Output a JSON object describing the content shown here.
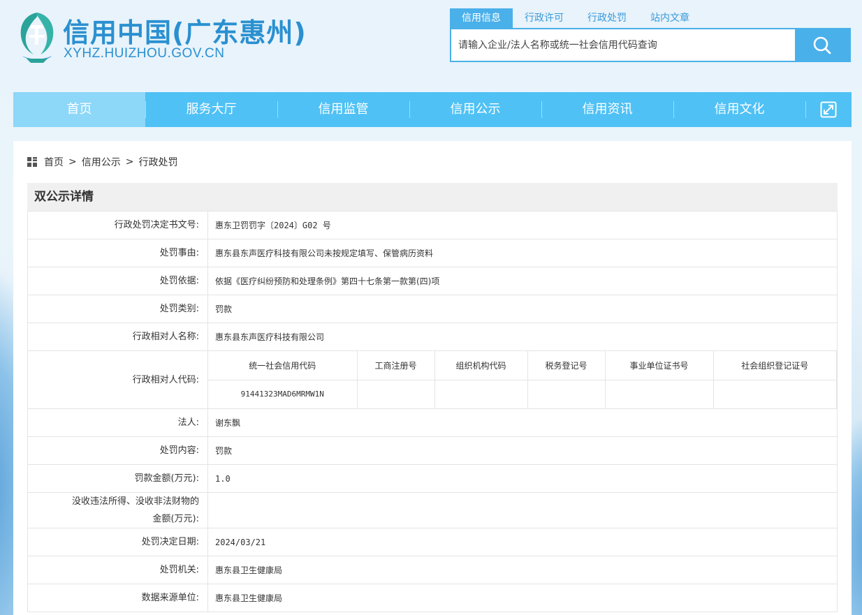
{
  "header": {
    "site_title": "信用中国(广东惠州)",
    "site_domain": "XYHZ.HUIZHOU.GOV.CN",
    "search_tabs": [
      "信用信息",
      "行政许可",
      "行政处罚",
      "站内文章"
    ],
    "search_placeholder": "请输入企业/法人名称或统一社会信用代码查询"
  },
  "nav": {
    "items": [
      "首页",
      "服务大厅",
      "信用监管",
      "信用公示",
      "信用资讯",
      "信用文化"
    ]
  },
  "breadcrumb": {
    "home": "首页",
    "sep": ">",
    "level1": "信用公示",
    "level2": "行政处罚"
  },
  "detail": {
    "title": "双公示详情",
    "rows": {
      "decision_no": {
        "label": "行政处罚决定书文号:",
        "value": "惠东卫罚罚字〔2024〕G02 号"
      },
      "reason": {
        "label": "处罚事由:",
        "value": "惠东县东声医疗科技有限公司未按规定填写、保管病历资料"
      },
      "basis": {
        "label": "处罚依据:",
        "value": "依据《医疗纠纷预防和处理条例》第四十七条第一款第(四)项"
      },
      "category": {
        "label": "处罚类别:",
        "value": "罚款"
      },
      "party_name": {
        "label": "行政相对人名称:",
        "value": "惠东县东声医疗科技有限公司"
      },
      "party_code": {
        "label": "行政相对人代码:",
        "headers": [
          "统一社会信用代码",
          "工商注册号",
          "组织机构代码",
          "税务登记号",
          "事业单位证书号",
          "社会组织登记证号"
        ],
        "values": [
          "91441323MAD6MRMW1N",
          "",
          "",
          "",
          "",
          ""
        ]
      },
      "legal_person": {
        "label": "法人:",
        "value": "谢东飘"
      },
      "content": {
        "label": "处罚内容:",
        "value": "罚款"
      },
      "fine_amount": {
        "label": "罚款金额(万元):",
        "value": "1.0"
      },
      "confiscation": {
        "label_line1": "没收违法所得、没收非法财物的",
        "label_line2": "金额(万元):",
        "value": ""
      },
      "decision_date": {
        "label": "处罚决定日期:",
        "value": "2024/03/21"
      },
      "authority": {
        "label": "处罚机关:",
        "value": "惠东县卫生健康局"
      },
      "source": {
        "label": "数据来源单位:",
        "value": "惠东县卫生健康局"
      }
    }
  },
  "colors": {
    "primary": "#4ab0ea",
    "nav_bg": "#4fc1f5",
    "nav_active": "#8dd7f8",
    "title_blue": "#2a90d0"
  }
}
